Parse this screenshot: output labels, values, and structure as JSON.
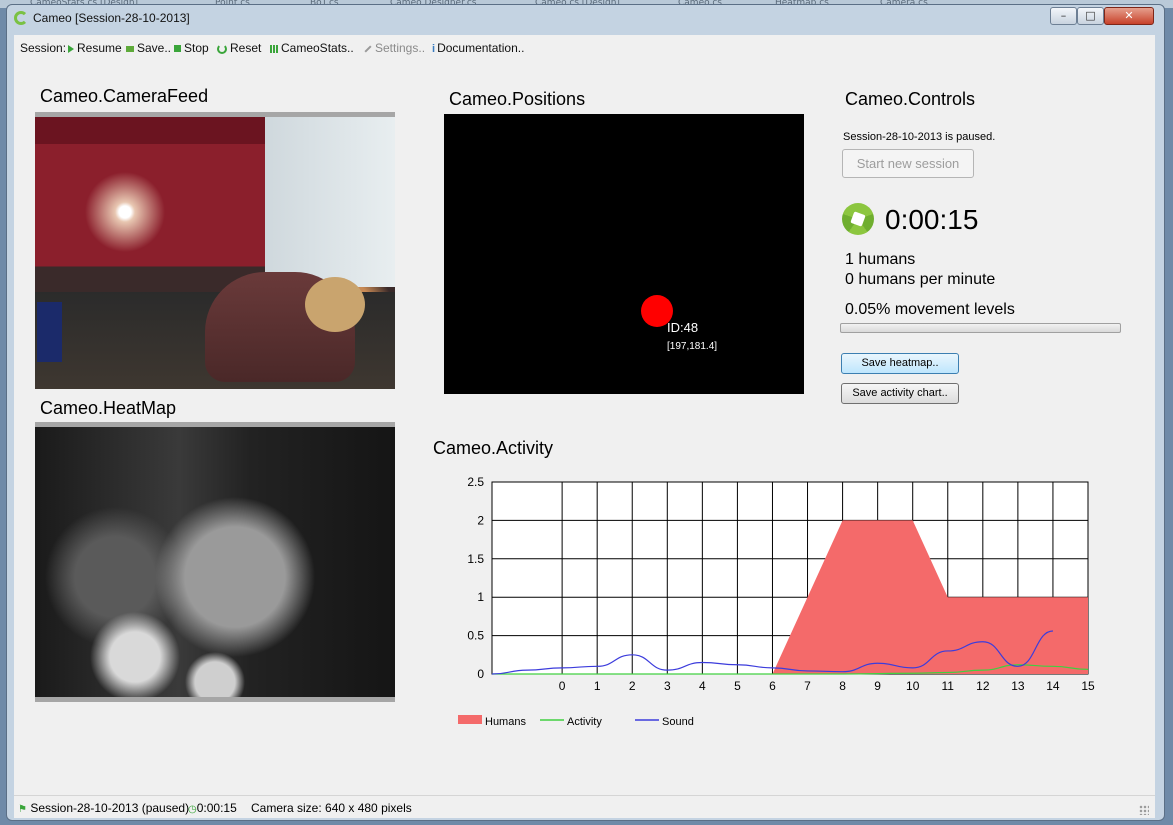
{
  "background_tabs": [
    "CameoStats.cs [Design]",
    "Point.cs",
    "BoT.cs",
    "Cameo Designer.cs",
    "Cameo.cs [Design]",
    "Cameo.cs",
    "Heatmap.cs",
    "Camera.cs"
  ],
  "window": {
    "title": "Cameo [Session-28-10-2013]",
    "minimize": "–",
    "maximize": "□",
    "close": "✕"
  },
  "toolbar": {
    "label": "Session:",
    "resume": "Resume",
    "save": "Save..",
    "stop": "Stop",
    "reset": "Reset",
    "stats": "CameoStats..",
    "settings": "Settings..",
    "documentation": "Documentation.."
  },
  "camera_feed": {
    "title": "Cameo.CameraFeed"
  },
  "heatmap": {
    "title": "Cameo.HeatMap"
  },
  "positions": {
    "title": "Cameo.Positions",
    "tracked": {
      "id_label": "ID:48",
      "coords": "[197,181.4]"
    }
  },
  "controls": {
    "title": "Cameo.Controls",
    "status": "Session-28-10-2013  is paused.",
    "start_new": "Start new session",
    "timer": "0:00:15",
    "humans": "1 humans",
    "humans_per_minute": "0 humans per minute",
    "movement": "0.05% movement levels",
    "movement_fraction": 0.0,
    "save_heatmap": "Save heatmap..",
    "save_activity": "Save activity chart.."
  },
  "activity": {
    "title": "Cameo.Activity"
  },
  "chart_data": {
    "type": "area",
    "x": [
      0,
      1,
      2,
      3,
      4,
      5,
      6,
      7,
      8,
      9,
      10,
      11,
      12,
      13,
      14,
      15
    ],
    "ylim": [
      0,
      2.5
    ],
    "xlim": [
      -2,
      15
    ],
    "yticks": [
      "0",
      "0.5",
      "1",
      "1.5",
      "2",
      "2.5"
    ],
    "xticks": [
      "0",
      "1",
      "2",
      "3",
      "4",
      "5",
      "6",
      "7",
      "8",
      "9",
      "10",
      "11",
      "12",
      "13",
      "14",
      "15"
    ],
    "grid": true,
    "legend_position": "bottom-left",
    "series": [
      {
        "name": "Humans",
        "type": "area",
        "color": "#f46a6a",
        "x": [
          6,
          8,
          10,
          11,
          15
        ],
        "values": [
          0,
          2,
          2,
          1,
          1
        ]
      },
      {
        "name": "Activity",
        "type": "line",
        "color": "#40d040",
        "x": [
          -2,
          0,
          2,
          4,
          6,
          8,
          10,
          11,
          12,
          13,
          14,
          15
        ],
        "values": [
          0,
          0,
          0,
          0,
          0,
          0,
          0.01,
          0.02,
          0.05,
          0.12,
          0.1,
          0.06
        ]
      },
      {
        "name": "Sound",
        "type": "line",
        "color": "#3c3cdc",
        "x": [
          -2,
          -1,
          0,
          1,
          2,
          3,
          4,
          5,
          6,
          7,
          8,
          9,
          10,
          11,
          12,
          13,
          14
        ],
        "values": [
          0,
          0.05,
          0.08,
          0.1,
          0.25,
          0.05,
          0.15,
          0.12,
          0.08,
          0.04,
          0.03,
          0.14,
          0.08,
          0.3,
          0.42,
          0.1,
          0.56
        ]
      }
    ]
  },
  "statusbar": {
    "session": "Session-28-10-2013 (paused)",
    "time": "0:00:15",
    "camera": "Camera size: 640 x 480 pixels"
  }
}
